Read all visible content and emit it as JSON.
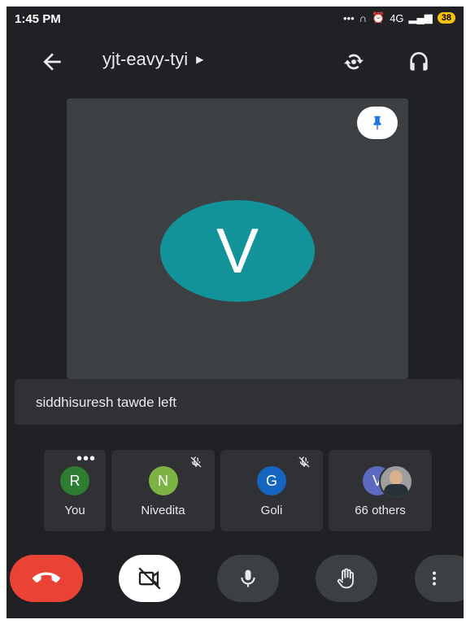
{
  "status_bar": {
    "time": "1:45 PM",
    "network": "4G",
    "battery": "38"
  },
  "header": {
    "meeting_code": "yjt-eavy-tyi"
  },
  "main_tile": {
    "initial": "V",
    "avatar_color": "#12939a"
  },
  "notification": {
    "text": "siddhisuresh tawde left"
  },
  "participants": [
    {
      "initial": "R",
      "name": "You",
      "color": "#2e7d32"
    },
    {
      "initial": "N",
      "name": "Nivedita",
      "color": "#7cb342"
    },
    {
      "initial": "G",
      "name": "Goli",
      "color": "#1565c0"
    },
    {
      "initial": "V",
      "name": "66 others",
      "color": "#5c6bc0"
    }
  ],
  "controls": {
    "end_call_color": "#ea4335",
    "camera_off_bg": "#ffffff"
  }
}
